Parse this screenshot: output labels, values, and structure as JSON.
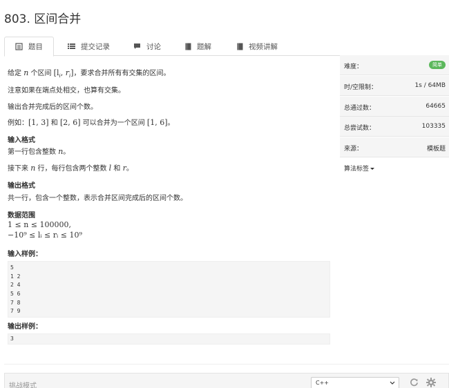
{
  "problem": {
    "title": "803. 区间合并"
  },
  "tabs": [
    {
      "label": "题目",
      "icon": "book-icon",
      "active": true
    },
    {
      "label": "提交记录",
      "icon": "list-icon"
    },
    {
      "label": "讨论",
      "icon": "comment-icon"
    },
    {
      "label": "题解",
      "icon": "book-icon"
    },
    {
      "label": "视频讲解",
      "icon": "video-book-icon"
    }
  ],
  "description": {
    "line1_prefix": "给定",
    "line1_n": "n",
    "line1_mid": "个区间",
    "line1_interval": "[l",
    "line1_suffix": "，要求合并所有有交集的区间。",
    "line2": "注意如果在端点处相交，也算有交集。",
    "line3": "输出合并完成后的区间个数。",
    "ex_prefix": "例如：",
    "ex_a": "[1, 3]",
    "ex_and": "和",
    "ex_b": "[2, 6]",
    "ex_mid": "可以合并为一个区间",
    "ex_c": "[1, 6]",
    "ex_end": "。"
  },
  "input_format": {
    "heading": "输入格式",
    "line1_prefix": "第一行包含整数",
    "line1_var": "n",
    "line1_end": "。",
    "line2_prefix": "接下来",
    "line2_var": "n",
    "line2_mid": "行，每行包含两个整数",
    "line2_l": "l",
    "line2_and": "和",
    "line2_r": "r",
    "line2_end": "。"
  },
  "output_format": {
    "heading": "输出格式",
    "line1": "共一行，包含一个整数，表示合并区间完成后的区间个数。"
  },
  "range": {
    "heading": "数据范围",
    "line1": "1 ≤ n ≤ 100000,",
    "line2": "−10⁹ ≤ lᵢ ≤ rᵢ ≤ 10⁹"
  },
  "sample_input": {
    "heading": "输入样例：",
    "lines": [
      "5",
      "1 2",
      "2 4",
      "5 6",
      "7 8",
      "7 9"
    ]
  },
  "sample_output": {
    "heading": "输出样例：",
    "lines": [
      "3"
    ]
  },
  "sidebar": {
    "difficulty_label": "难度：",
    "difficulty_value": "简单",
    "limit_label": "时/空限制：",
    "limit_value": "1s / 64MB",
    "passed_label": "总通过数：",
    "passed_value": "64665",
    "tried_label": "总尝试数：",
    "tried_value": "103335",
    "source_label": "来源：",
    "source_value": "模板题",
    "tags_label": "算法标签"
  },
  "editor": {
    "mode_label": "挑战模式",
    "language": "C++"
  },
  "colors": {
    "badge": "#5cb85c",
    "panel": "#f5f5f5"
  }
}
